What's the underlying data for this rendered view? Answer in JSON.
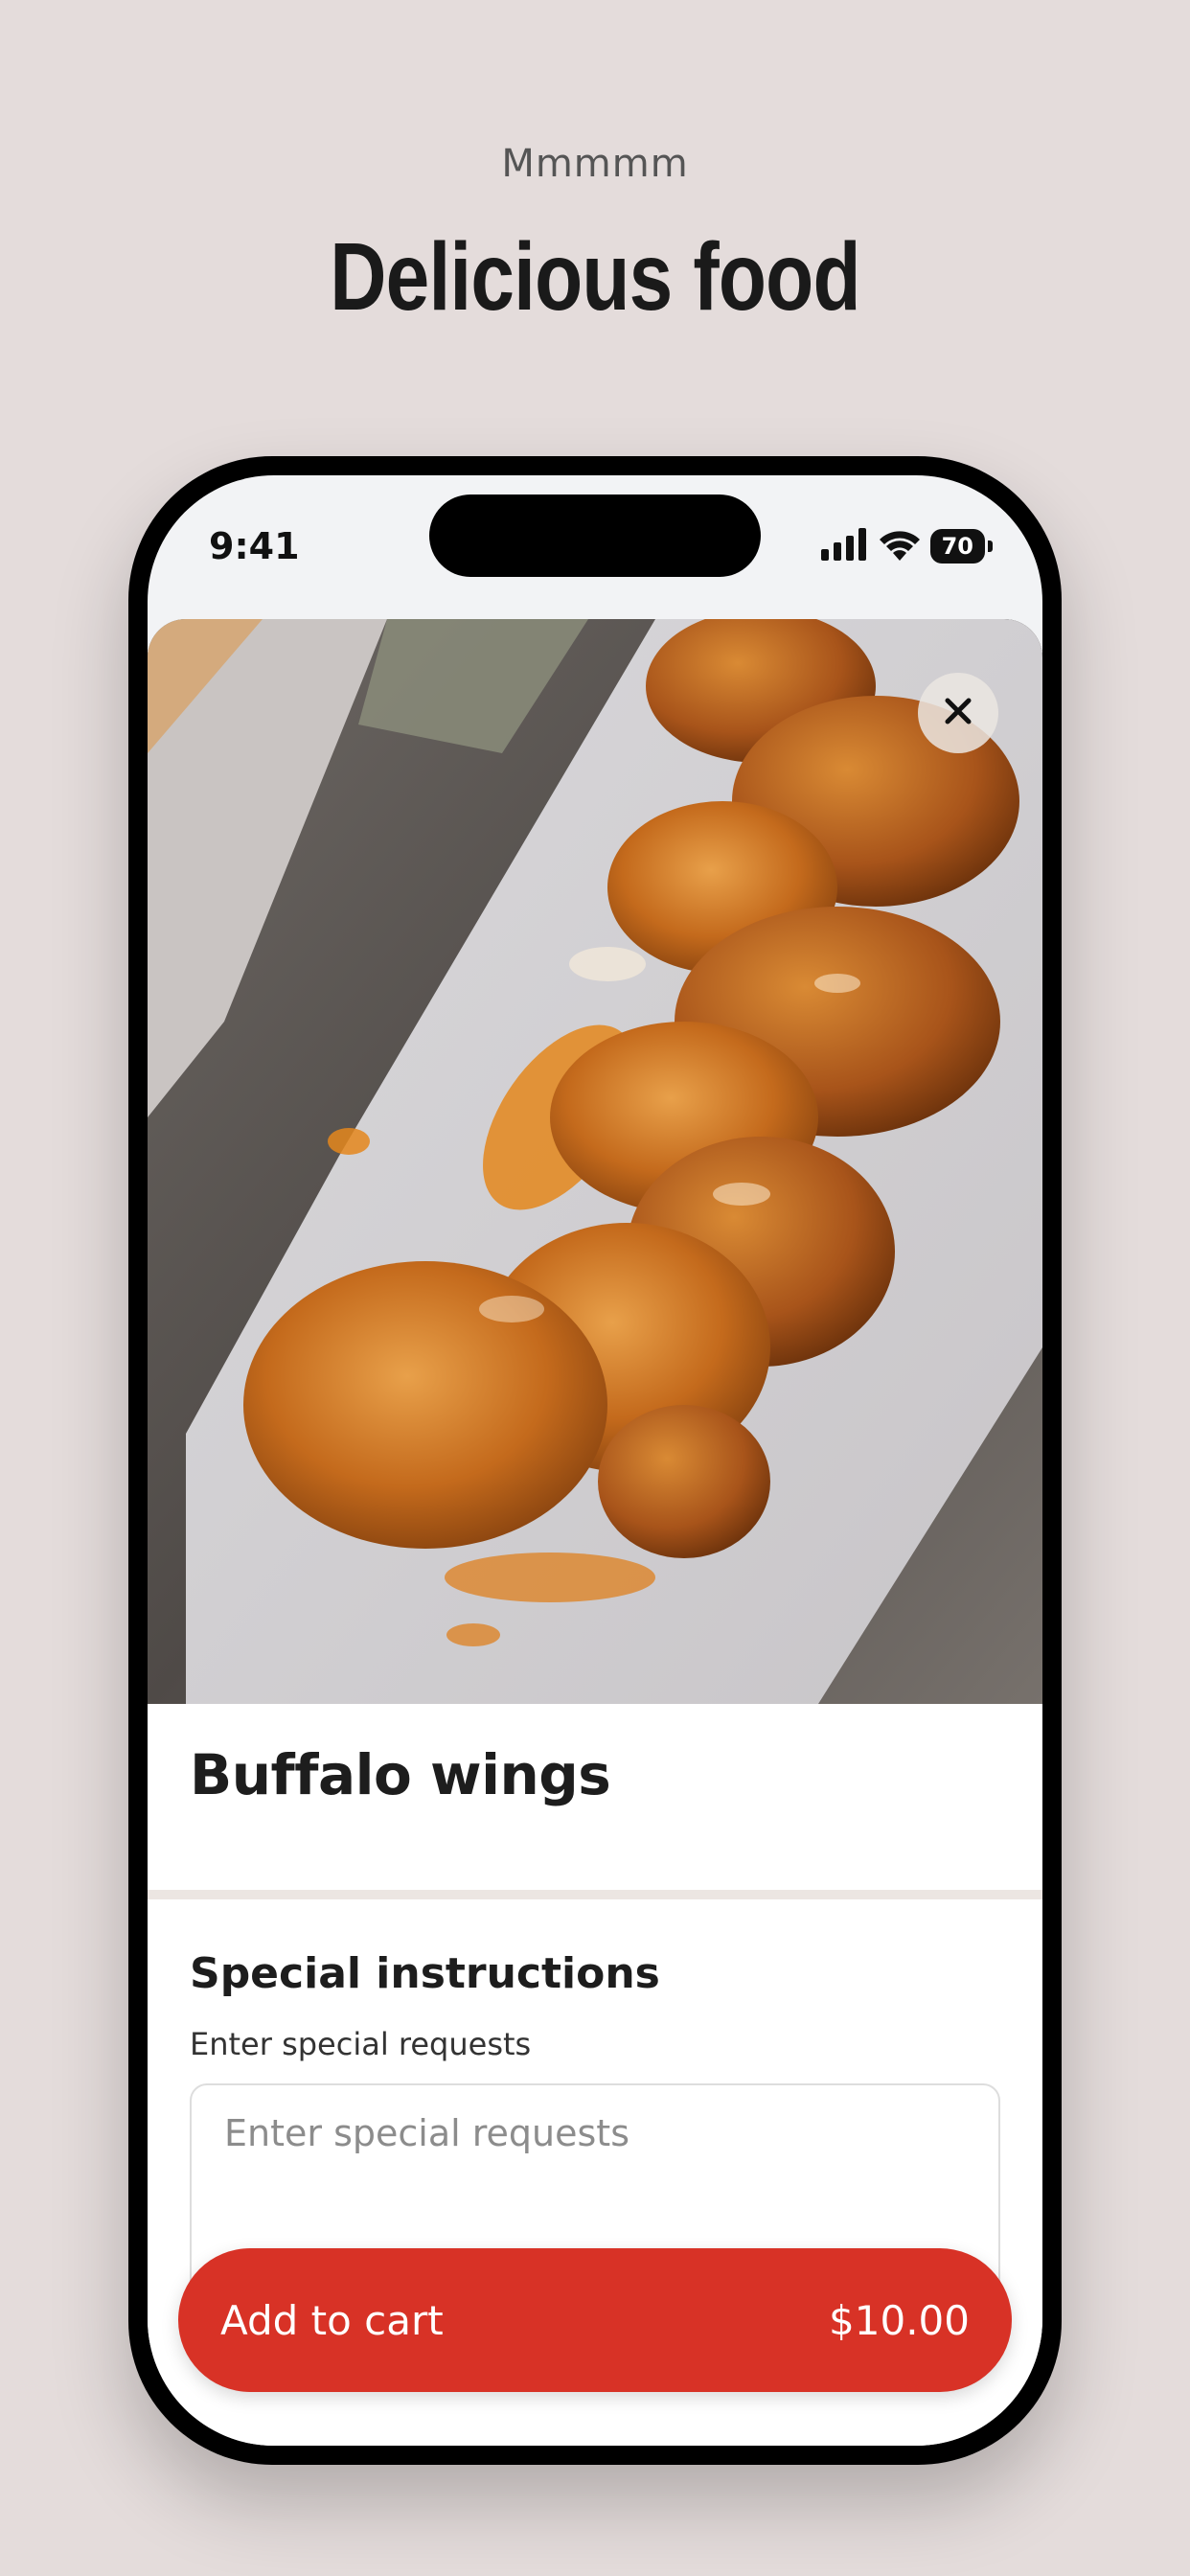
{
  "promo": {
    "tagline": "Mmmmm",
    "headline": "Delicious food"
  },
  "status_bar": {
    "time": "9:41",
    "battery": "70",
    "icons": [
      "signal-icon",
      "wifi-icon",
      "battery-icon"
    ]
  },
  "item": {
    "name": "Buffalo wings",
    "image": "buffalo-wings-photo"
  },
  "special_instructions": {
    "title": "Special instructions",
    "label": "Enter special requests",
    "placeholder": "Enter special requests",
    "value": ""
  },
  "cart_button": {
    "label": "Add to cart",
    "price": "$10.00"
  },
  "colors": {
    "background": "#e4dcdb",
    "accent": "#d83226",
    "phone_frame": "#000000"
  }
}
